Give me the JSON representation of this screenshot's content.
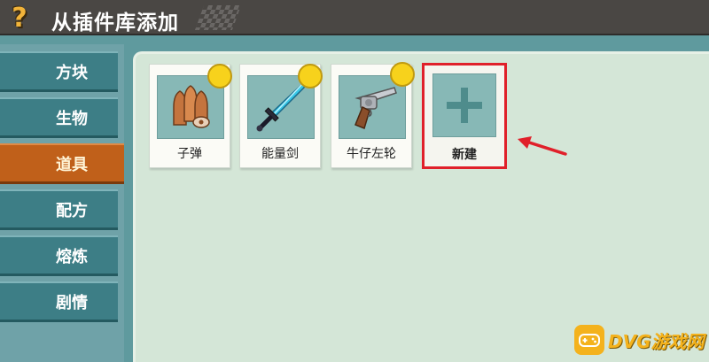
{
  "header": {
    "help_symbol": "?",
    "title": "从插件库添加"
  },
  "sidebar": {
    "items": [
      {
        "label": "方块"
      },
      {
        "label": "生物"
      },
      {
        "label": "道具",
        "active": true
      },
      {
        "label": "配方"
      },
      {
        "label": "熔炼"
      },
      {
        "label": "剧情"
      }
    ]
  },
  "main": {
    "cards": [
      {
        "label": "子弹",
        "icon": "bullets-icon"
      },
      {
        "label": "能量剑",
        "icon": "energy-sword-icon"
      },
      {
        "label": "牛仔左轮",
        "icon": "revolver-icon"
      }
    ],
    "new_card": {
      "label": "新建",
      "icon": "plus-icon"
    }
  },
  "colors": {
    "header_bg": "#4a4744",
    "sidebar_item": "#3d7e86",
    "sidebar_active": "#c0601a",
    "panel_bg": "#d4e6d7",
    "badge": "#f7d21c",
    "highlight": "#e0202a"
  },
  "watermark": {
    "text": "DVG游戏网"
  }
}
